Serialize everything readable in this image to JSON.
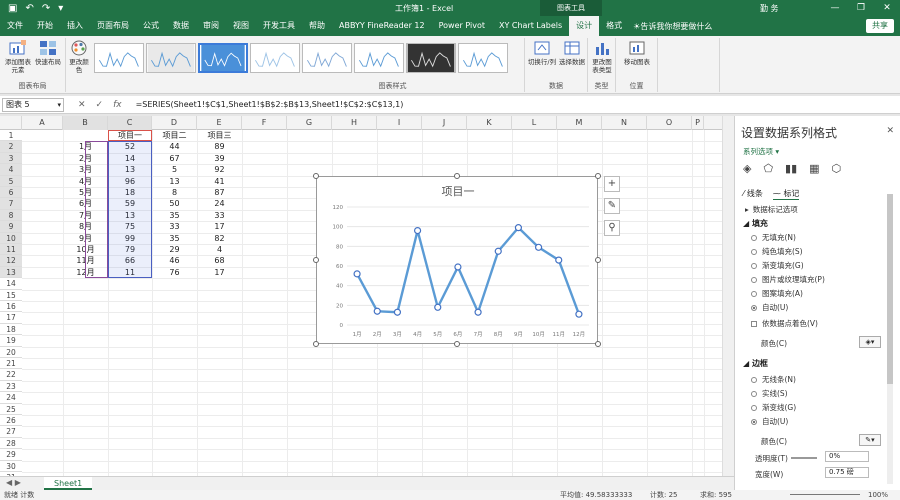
{
  "titlebar": {
    "title": "工作簿1 - Excel",
    "context_tab": "图表工具",
    "user": "勤 务",
    "controls": [
      "—",
      "❐",
      "✕"
    ]
  },
  "tabs": [
    "文件",
    "开始",
    "插入",
    "页面布局",
    "公式",
    "数据",
    "审阅",
    "视图",
    "开发工具",
    "帮助",
    "ABBYY FineReader 12",
    "Power Pivot",
    "XY Chart Labels",
    "设计",
    "格式"
  ],
  "active_tab": "设计",
  "tell_me": "告诉我你想要做什么",
  "share": "共享",
  "ribbon": {
    "group_layout": {
      "label": "图表布局",
      "add_element": "添加图表元素",
      "quick_layout": "快速布局"
    },
    "change_colors": "更改颜色",
    "group_styles": "图表样式",
    "group_data": {
      "label": "数据",
      "switch": "切换行/列",
      "select": "选择数据"
    },
    "group_type": {
      "label": "类型",
      "change": "更改图表类型"
    },
    "group_location": {
      "label": "位置",
      "move": "移动图表"
    }
  },
  "formula_bar": {
    "name_box": "图表 5",
    "formula": "=SERIES(Sheet1!$C$1,Sheet1!$B$2:$B$13,Sheet1!$C$2:$C$13,1)"
  },
  "grid": {
    "columns": [
      "A",
      "B",
      "C",
      "D",
      "E",
      "F",
      "G",
      "H",
      "I",
      "J",
      "K",
      "L",
      "M",
      "N",
      "O",
      "P"
    ],
    "rows": [
      "1",
      "2",
      "3",
      "4",
      "5",
      "6",
      "7",
      "8",
      "9",
      "10",
      "11",
      "12",
      "13",
      "14",
      "15",
      "16",
      "17",
      "18",
      "19",
      "20",
      "21",
      "22",
      "23",
      "24",
      "25",
      "26",
      "27",
      "28",
      "29",
      "30",
      "31"
    ],
    "headers": [
      "项目一",
      "项目二",
      "项目三"
    ],
    "months": [
      "1月",
      "2月",
      "3月",
      "4月",
      "5月",
      "6月",
      "7月",
      "8月",
      "9月",
      "10月",
      "11月",
      "12月"
    ],
    "col_c": [
      "52",
      "14",
      "13",
      "96",
      "18",
      "59",
      "13",
      "75",
      "99",
      "79",
      "66",
      "11"
    ],
    "col_d": [
      "44",
      "67",
      "5",
      "13",
      "8",
      "50",
      "35",
      "33",
      "35",
      "29",
      "46",
      "76"
    ],
    "col_e": [
      "89",
      "39",
      "92",
      "41",
      "87",
      "24",
      "33",
      "17",
      "82",
      "4",
      "68",
      "17"
    ]
  },
  "chart_data": {
    "type": "line",
    "title": "项目一",
    "categories": [
      "1月",
      "2月",
      "3月",
      "4月",
      "5月",
      "6月",
      "7月",
      "8月",
      "9月",
      "10月",
      "11月",
      "12月"
    ],
    "series": [
      {
        "name": "项目一",
        "values": [
          52,
          14,
          13,
          96,
          18,
          59,
          13,
          75,
          99,
          79,
          66,
          11
        ]
      }
    ],
    "ylim": [
      0,
      120
    ],
    "yticks": [
      "0",
      "20",
      "40",
      "60",
      "80",
      "100",
      "120"
    ],
    "grid": true,
    "line_color": "#5b9bd5"
  },
  "sheet_tab": "Sheet1",
  "status": {
    "left": "就绪   计数",
    "avg": "平均值: 49.58333333",
    "count": "计数: 25",
    "sum": "求和: 595",
    "zoom": "100%"
  },
  "pane": {
    "title": "设置数据系列格式",
    "subtitle": "系列选项",
    "tab_line": "线条",
    "tab_marker": "标记",
    "marker_options": "数据标记选项",
    "fill_head": "填充",
    "fill_options": [
      "无填充(N)",
      "纯色填充(S)",
      "渐变填充(G)",
      "图片或纹理填充(P)",
      "图案填充(A)",
      "自动(U)"
    ],
    "vary_colors": "依数据点着色(V)",
    "color_label": "颜色(C)",
    "border_head": "边框",
    "border_options": [
      "无线条(N)",
      "实线(S)",
      "渐变线(G)",
      "自动(U)"
    ],
    "color_label2": "颜色(C)",
    "transparency_label": "透明度(T)",
    "transparency_value": "0%",
    "width_label": "宽度(W)",
    "width_value": "0.75 磅"
  },
  "colors": {
    "excel_green": "#217346",
    "accent_blue": "#3c7bd9"
  }
}
